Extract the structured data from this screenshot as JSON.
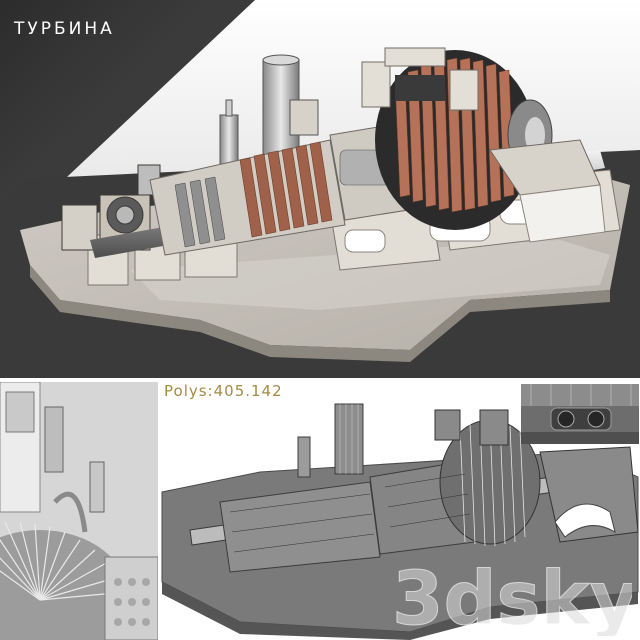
{
  "top_panel": {
    "title": "ТУРБИНА"
  },
  "bottom_right_panel": {
    "polys_label": "Polys:",
    "polys_value": "405.142"
  },
  "watermark": {
    "text": "3dsky"
  },
  "colors": {
    "top_background": "#3a3a3a",
    "polys_text": "#a48a42",
    "model_gray": "#8d8d8d",
    "blade_copper": "#a0614a"
  }
}
